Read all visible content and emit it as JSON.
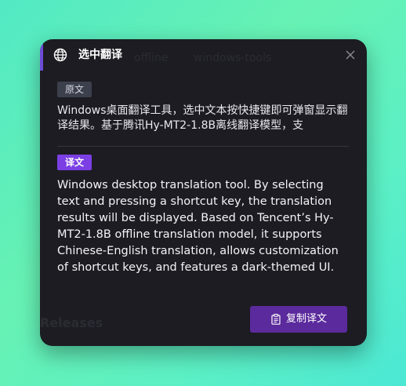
{
  "popup": {
    "title": "选中翻译",
    "source_badge": "原文",
    "source_text": "Windows桌面翻译工具，选中文本按快捷键即可弹窗显示翻译结果。基于腾讯Hy-MT2-1.8B离线翻译模型，支",
    "result_badge": "译文",
    "result_text": "Windows desktop translation tool. By selecting text and pressing a shortcut key, the translation results will be displayed. Based on Tencent’s Hy-MT2-1.8B offline translation model, it supports Chinese-English translation, allows customization of shortcut keys, and features a dark-themed UI.",
    "copy_button": "复制译文",
    "icons": {
      "title": "globe-icon",
      "close": "close-icon",
      "copy": "clipboard-icon"
    }
  },
  "background": {
    "ghost_1": "offline",
    "ghost_2": "windows-tools",
    "ghost_3": "Releases"
  },
  "colors": {
    "panel": "#1c1c22",
    "accent": "#7b3fe4",
    "button": "#5b2a9c",
    "source_badge": "#3c3f4c"
  }
}
